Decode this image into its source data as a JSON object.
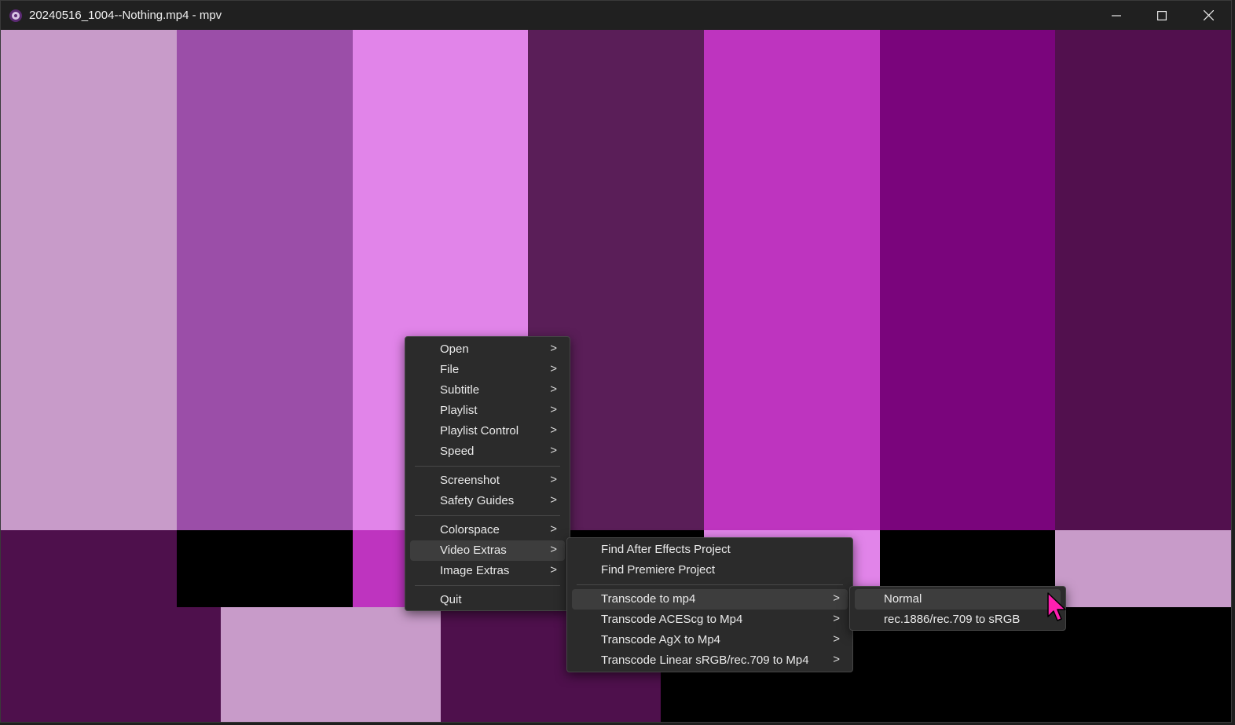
{
  "window": {
    "title": "20240516_1004--Nothing.mp4 - mpv",
    "controls": [
      "minimize-icon",
      "maximize-icon",
      "close-icon"
    ]
  },
  "video_frame": {
    "top_bars": [
      "#c89bc9",
      "#9b4ea8",
      "#e184e9",
      "#5a1e58",
      "#be34bf",
      "#7a057c",
      "#52104e"
    ],
    "middle_bars": [
      "#4e104c",
      "#000000",
      "#be34bf",
      "#000000",
      "#e184e9",
      "#000000",
      "#c89bc9"
    ],
    "bottom_bars": [
      "#4e104c",
      "#c89bc9",
      "#4e104c",
      "#000000"
    ]
  },
  "context_menu": {
    "items": [
      {
        "label": "Open",
        "submenu": true
      },
      {
        "label": "File",
        "submenu": true
      },
      {
        "label": "Subtitle",
        "submenu": true
      },
      {
        "label": "Playlist",
        "submenu": true
      },
      {
        "label": "Playlist Control",
        "submenu": true
      },
      {
        "label": "Speed",
        "submenu": true
      },
      {
        "label": "Screenshot",
        "submenu": true
      },
      {
        "label": "Safety Guides",
        "submenu": true
      },
      {
        "label": "Colorspace",
        "submenu": true
      },
      {
        "label": "Video Extras",
        "submenu": true,
        "highlighted": true
      },
      {
        "label": "Image Extras",
        "submenu": true
      },
      {
        "label": "Quit",
        "submenu": false
      }
    ]
  },
  "video_extras_menu": {
    "items": [
      {
        "label": "Find After Effects Project",
        "submenu": false
      },
      {
        "label": "Find Premiere Project",
        "submenu": false
      },
      {
        "label": "Transcode to mp4",
        "submenu": true,
        "highlighted": true
      },
      {
        "label": "Transcode ACEScg to Mp4",
        "submenu": true
      },
      {
        "label": "Transcode AgX to Mp4",
        "submenu": true
      },
      {
        "label": "Transcode Linear sRGB/rec.709 to Mp4",
        "submenu": true
      }
    ]
  },
  "transcode_menu": {
    "items": [
      {
        "label": "Normal",
        "highlighted": true
      },
      {
        "label": "rec.1886/rec.709 to sRGB"
      }
    ]
  },
  "submenu_arrow": ">",
  "colors": {
    "menu_bg": "#2b2b2b",
    "menu_highlight": "#3d3d3d",
    "titlebar_bg": "#202020",
    "cursor": "#ff1fb0"
  }
}
